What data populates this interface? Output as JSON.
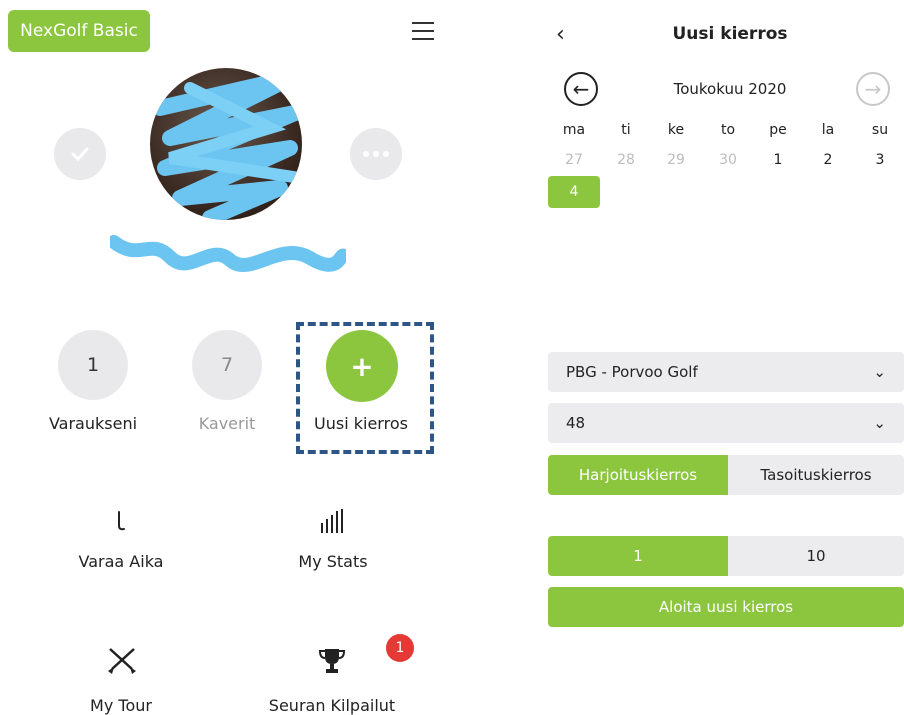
{
  "left": {
    "app_badge": "NexGolf Basic",
    "icons": {
      "menu": "hamburger-icon",
      "check_bubble": "check-bubble-icon",
      "chat_bubble": "chat-bubble-icon"
    },
    "stats": [
      {
        "value": "1",
        "label": "Varaukseni"
      },
      {
        "value": "7",
        "label": "Kaverit"
      },
      {
        "value": "+",
        "label": "Uusi kierros"
      }
    ],
    "menu_items": [
      {
        "label": "Varaa Aika",
        "icon": "golf-club-icon"
      },
      {
        "label": "My Stats",
        "icon": "bar-stats-icon"
      },
      {
        "label": "My Tour",
        "icon": "crossed-clubs-icon"
      },
      {
        "label": "Seuran Kilpailut",
        "icon": "trophy-icon",
        "badge": "1"
      }
    ]
  },
  "right": {
    "back_icon": "chevron-left-icon",
    "title": "Uusi kierros",
    "calendar": {
      "month": "Toukokuu 2020",
      "prev_icon": "arrow-left-circle-icon",
      "next_icon": "arrow-right-circle-icon",
      "weekdays": [
        "ma",
        "ti",
        "ke",
        "to",
        "pe",
        "la",
        "su"
      ],
      "week1": [
        "27",
        "28",
        "29",
        "30",
        "1",
        "2",
        "3"
      ],
      "selected_day": "4"
    },
    "course_select": "PBG - Porvoo Golf",
    "holes_select": "48",
    "round_type": {
      "options": [
        "Harjoituskierros",
        "Tasoituskierros"
      ],
      "selected": "Harjoituskierros"
    },
    "players": {
      "options": [
        "1",
        "10"
      ],
      "selected": "1"
    },
    "start_button": "Aloita uusi kierros"
  },
  "colors": {
    "accent": "#8cc63f",
    "highlight_border": "#2d5585",
    "badge": "#e53935",
    "neutral": "#ececef"
  }
}
